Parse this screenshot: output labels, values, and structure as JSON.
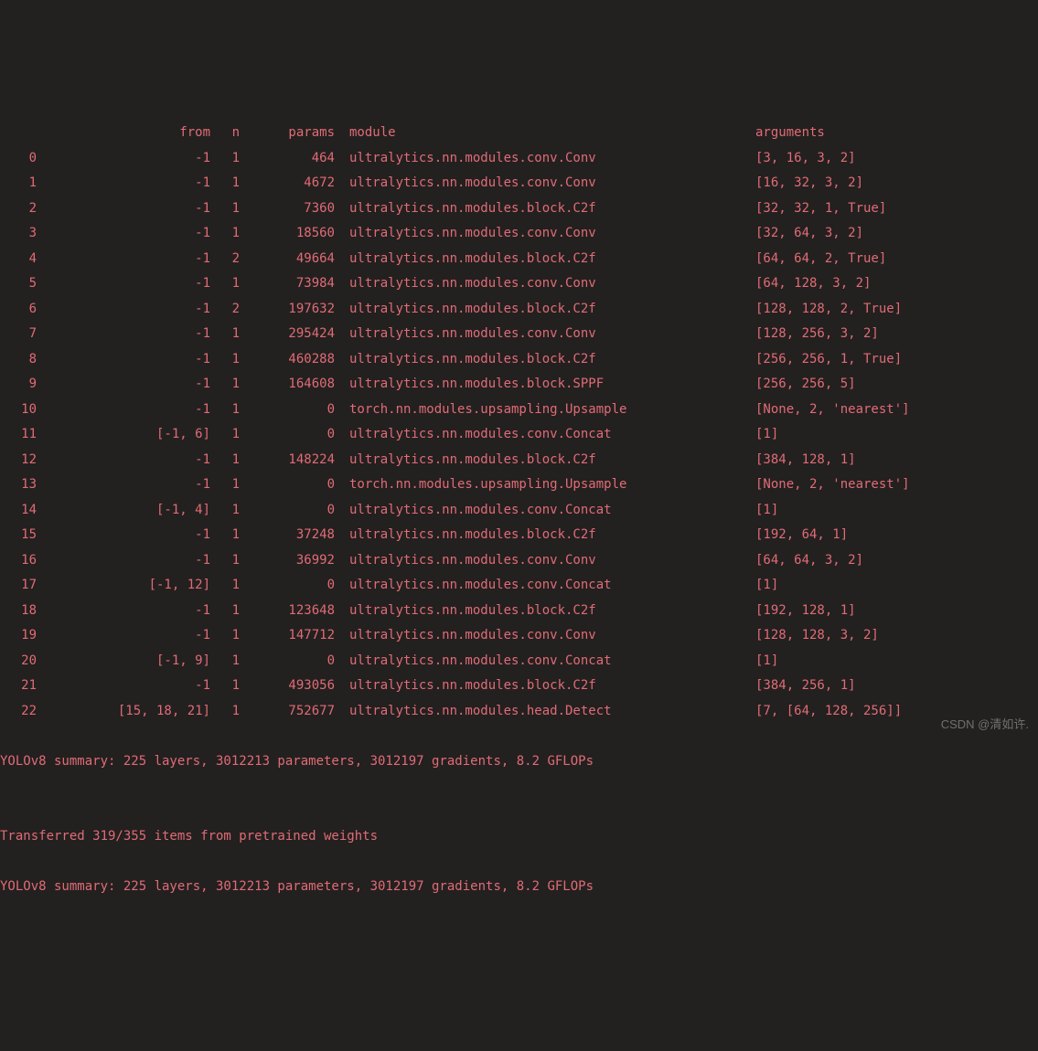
{
  "headers": {
    "from": "from",
    "n": "n",
    "params": "params",
    "module": "module",
    "arguments": "arguments"
  },
  "rows": [
    {
      "idx": "0",
      "from": "-1",
      "n": "1",
      "params": "464",
      "module": "ultralytics.nn.modules.conv.Conv",
      "args": "[3, 16, 3, 2]"
    },
    {
      "idx": "1",
      "from": "-1",
      "n": "1",
      "params": "4672",
      "module": "ultralytics.nn.modules.conv.Conv",
      "args": "[16, 32, 3, 2]"
    },
    {
      "idx": "2",
      "from": "-1",
      "n": "1",
      "params": "7360",
      "module": "ultralytics.nn.modules.block.C2f",
      "args": "[32, 32, 1, True]"
    },
    {
      "idx": "3",
      "from": "-1",
      "n": "1",
      "params": "18560",
      "module": "ultralytics.nn.modules.conv.Conv",
      "args": "[32, 64, 3, 2]"
    },
    {
      "idx": "4",
      "from": "-1",
      "n": "2",
      "params": "49664",
      "module": "ultralytics.nn.modules.block.C2f",
      "args": "[64, 64, 2, True]"
    },
    {
      "idx": "5",
      "from": "-1",
      "n": "1",
      "params": "73984",
      "module": "ultralytics.nn.modules.conv.Conv",
      "args": "[64, 128, 3, 2]"
    },
    {
      "idx": "6",
      "from": "-1",
      "n": "2",
      "params": "197632",
      "module": "ultralytics.nn.modules.block.C2f",
      "args": "[128, 128, 2, True]"
    },
    {
      "idx": "7",
      "from": "-1",
      "n": "1",
      "params": "295424",
      "module": "ultralytics.nn.modules.conv.Conv",
      "args": "[128, 256, 3, 2]"
    },
    {
      "idx": "8",
      "from": "-1",
      "n": "1",
      "params": "460288",
      "module": "ultralytics.nn.modules.block.C2f",
      "args": "[256, 256, 1, True]"
    },
    {
      "idx": "9",
      "from": "-1",
      "n": "1",
      "params": "164608",
      "module": "ultralytics.nn.modules.block.SPPF",
      "args": "[256, 256, 5]"
    },
    {
      "idx": "10",
      "from": "-1",
      "n": "1",
      "params": "0",
      "module": "torch.nn.modules.upsampling.Upsample",
      "args": "[None, 2, 'nearest']"
    },
    {
      "idx": "11",
      "from": "[-1, 6]",
      "n": "1",
      "params": "0",
      "module": "ultralytics.nn.modules.conv.Concat",
      "args": "[1]"
    },
    {
      "idx": "12",
      "from": "-1",
      "n": "1",
      "params": "148224",
      "module": "ultralytics.nn.modules.block.C2f",
      "args": "[384, 128, 1]"
    },
    {
      "idx": "13",
      "from": "-1",
      "n": "1",
      "params": "0",
      "module": "torch.nn.modules.upsampling.Upsample",
      "args": "[None, 2, 'nearest']"
    },
    {
      "idx": "14",
      "from": "[-1, 4]",
      "n": "1",
      "params": "0",
      "module": "ultralytics.nn.modules.conv.Concat",
      "args": "[1]"
    },
    {
      "idx": "15",
      "from": "-1",
      "n": "1",
      "params": "37248",
      "module": "ultralytics.nn.modules.block.C2f",
      "args": "[192, 64, 1]"
    },
    {
      "idx": "16",
      "from": "-1",
      "n": "1",
      "params": "36992",
      "module": "ultralytics.nn.modules.conv.Conv",
      "args": "[64, 64, 3, 2]"
    },
    {
      "idx": "17",
      "from": "[-1, 12]",
      "n": "1",
      "params": "0",
      "module": "ultralytics.nn.modules.conv.Concat",
      "args": "[1]"
    },
    {
      "idx": "18",
      "from": "-1",
      "n": "1",
      "params": "123648",
      "module": "ultralytics.nn.modules.block.C2f",
      "args": "[192, 128, 1]"
    },
    {
      "idx": "19",
      "from": "-1",
      "n": "1",
      "params": "147712",
      "module": "ultralytics.nn.modules.conv.Conv",
      "args": "[128, 128, 3, 2]"
    },
    {
      "idx": "20",
      "from": "[-1, 9]",
      "n": "1",
      "params": "0",
      "module": "ultralytics.nn.modules.conv.Concat",
      "args": "[1]"
    },
    {
      "idx": "21",
      "from": "-1",
      "n": "1",
      "params": "493056",
      "module": "ultralytics.nn.modules.block.C2f",
      "args": "[384, 256, 1]"
    },
    {
      "idx": "22",
      "from": "[15, 18, 21]",
      "n": "1",
      "params": "752677",
      "module": "ultralytics.nn.modules.head.Detect",
      "args": "[7, [64, 128, 256]]"
    }
  ],
  "footer": {
    "summary1": "YOLOv8 summary: 225 layers, 3012213 parameters, 3012197 gradients, 8.2 GFLOPs",
    "blank": "",
    "transfer": "Transferred 319/355 items from pretrained weights",
    "summary2": "YOLOv8 summary: 225 layers, 3012213 parameters, 3012197 gradients, 8.2 GFLOPs"
  },
  "watermark": "CSDN @清如许."
}
